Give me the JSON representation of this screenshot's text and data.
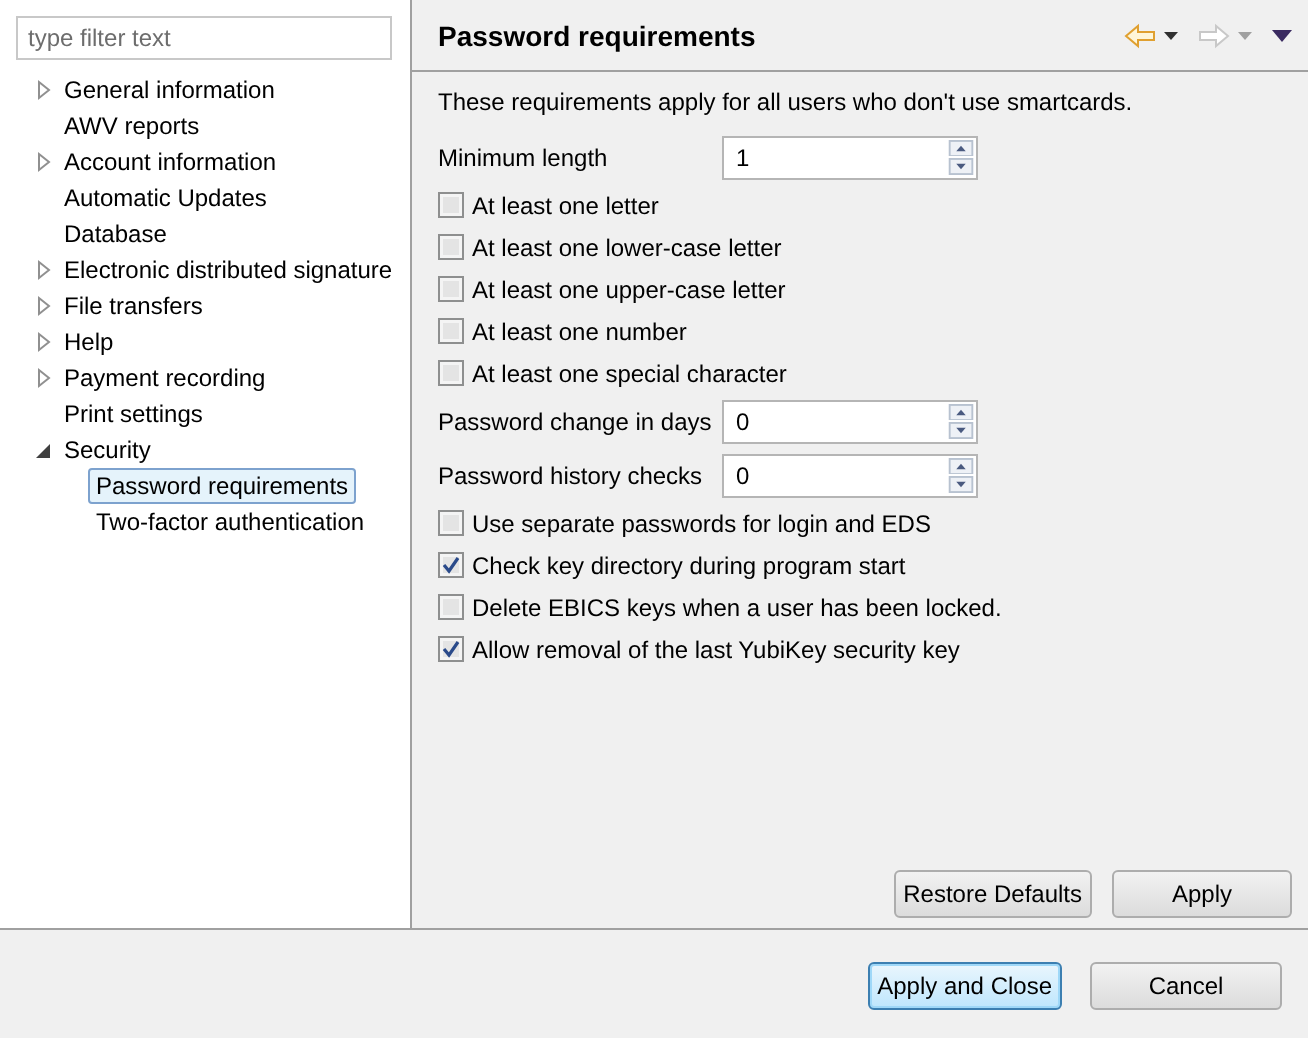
{
  "filter": {
    "placeholder": "type filter text"
  },
  "tree": [
    {
      "label": "General information",
      "expanded": false,
      "selected": false
    },
    {
      "label": "AWV reports",
      "selected": false
    },
    {
      "label": "Account information",
      "expanded": false,
      "selected": false
    },
    {
      "label": "Automatic Updates",
      "selected": false
    },
    {
      "label": "Database",
      "selected": false
    },
    {
      "label": "Electronic distributed signature",
      "expanded": false,
      "selected": false
    },
    {
      "label": "File transfers",
      "expanded": false,
      "selected": false
    },
    {
      "label": "Help",
      "expanded": false,
      "selected": false
    },
    {
      "label": "Payment recording",
      "expanded": false,
      "selected": false
    },
    {
      "label": "Print settings",
      "selected": false
    },
    {
      "label": "Security",
      "expanded": true,
      "selected": false,
      "children": [
        {
          "label": "Password requirements",
          "selected": true
        },
        {
          "label": "Two-factor authentication",
          "selected": false
        }
      ]
    }
  ],
  "page": {
    "title": "Password requirements",
    "back_enabled": true,
    "forward_enabled": false,
    "description": "These requirements apply for all users who don't use smartcards.",
    "fields": [
      {
        "kind": "spinner",
        "label": "Minimum length",
        "value": "1"
      },
      {
        "kind": "checkbox",
        "label": "At least one letter",
        "checked": false
      },
      {
        "kind": "checkbox",
        "label": "At least one lower-case letter",
        "checked": false
      },
      {
        "kind": "checkbox",
        "label": "At least one upper-case letter",
        "checked": false
      },
      {
        "kind": "checkbox",
        "label": "At least one number",
        "checked": false
      },
      {
        "kind": "checkbox",
        "label": "At least one special character",
        "checked": false
      },
      {
        "kind": "spinner",
        "label": "Password change in days",
        "value": "0"
      },
      {
        "kind": "spinner",
        "label": "Password history checks",
        "value": "0"
      },
      {
        "kind": "checkbox",
        "label": "Use separate passwords for login and EDS",
        "checked": false
      },
      {
        "kind": "checkbox",
        "label": "Check key directory during program start",
        "checked": true
      },
      {
        "kind": "checkbox",
        "label": "Delete EBICS keys when a user has been locked.",
        "checked": false
      },
      {
        "kind": "checkbox",
        "label": "Allow removal of the last YubiKey security key",
        "checked": true
      }
    ],
    "buttons": [
      "Restore Defaults",
      "Apply"
    ]
  },
  "dialog_buttons": [
    {
      "label": "Apply and Close",
      "default": true
    },
    {
      "label": "Cancel",
      "default": false
    }
  ]
}
